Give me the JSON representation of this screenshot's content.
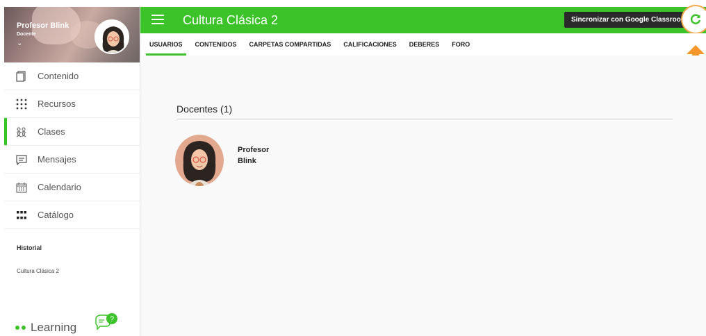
{
  "app": {
    "title": "Cultura Clásica 2",
    "brand": "Learning",
    "accent_color": "#3cc32a"
  },
  "profile": {
    "name": "Profesor Blink",
    "role": "Docente",
    "chevron": "⌄"
  },
  "sidebar": {
    "items": [
      {
        "label": "Contenido",
        "icon": "document-icon"
      },
      {
        "label": "Recursos",
        "icon": "grid-dots-icon"
      },
      {
        "label": "Clases",
        "icon": "people-icon",
        "active": true
      },
      {
        "label": "Mensajes",
        "icon": "message-icon"
      },
      {
        "label": "Calendario",
        "icon": "calendar-icon"
      },
      {
        "label": "Catálogo",
        "icon": "apps-icon"
      }
    ],
    "history_title": "Historial",
    "history_items": [
      "Cultura Clásica 2"
    ]
  },
  "toolbar": {
    "sync_label": "Sincronizar con Google Classroom"
  },
  "tabs": [
    {
      "label": "USUARIOS",
      "active": true
    },
    {
      "label": "CONTENIDOS"
    },
    {
      "label": "CARPETAS COMPARTIDAS"
    },
    {
      "label": "CALIFICACIONES"
    },
    {
      "label": "DEBERES"
    },
    {
      "label": "FORO"
    }
  ],
  "main": {
    "section_title": "Docentes (1)",
    "teachers": [
      {
        "first": "Profesor",
        "last": "Blink"
      }
    ]
  }
}
